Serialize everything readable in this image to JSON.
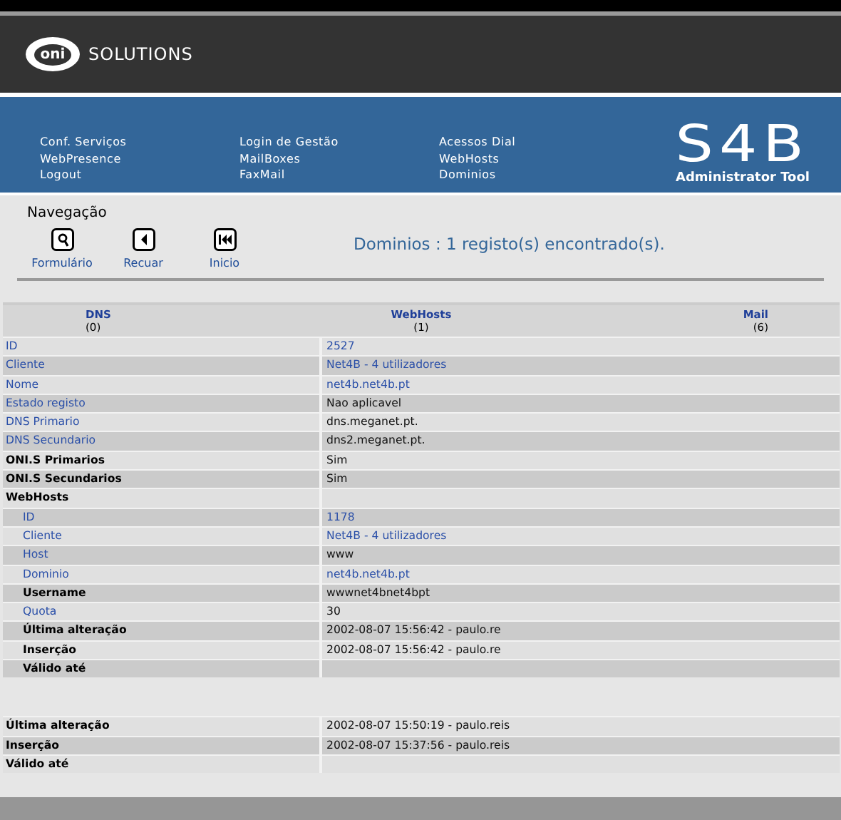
{
  "brand": {
    "logo_mark": "oni",
    "logo_text": "SOLUTIONS",
    "product": "S4B",
    "product_subtitle": "Administrator Tool"
  },
  "menu_columns": [
    [
      "Conf. Serviços",
      "WebPresence",
      "Logout"
    ],
    [
      "Login de Gestão",
      "MailBoxes",
      "FaxMail"
    ],
    [
      "Acessos Dial",
      "WebHosts",
      "Dominios"
    ]
  ],
  "navigation": {
    "title": "Navegação",
    "buttons": [
      {
        "kind": "search",
        "label": "Formulário"
      },
      {
        "kind": "back",
        "label": "Recuar"
      },
      {
        "kind": "first",
        "label": "Inicio"
      }
    ],
    "result": "Dominios : 1 registo(s) encontrado(s)."
  },
  "tabs": [
    {
      "label": "DNS",
      "count": "(0)"
    },
    {
      "label": "WebHosts",
      "count": "(1)"
    },
    {
      "label": "Mail",
      "count": "(6)"
    }
  ],
  "rows": [
    {
      "kind": "field",
      "label": "ID",
      "value": "2527",
      "label_link": true,
      "value_link": true,
      "indented": false
    },
    {
      "kind": "field",
      "label": "Cliente",
      "value": "Net4B - 4 utilizadores",
      "label_link": true,
      "value_link": true,
      "indented": false
    },
    {
      "kind": "field",
      "label": "Nome",
      "value": "net4b.net4b.pt",
      "label_link": true,
      "value_link": true,
      "indented": false
    },
    {
      "kind": "field",
      "label": "Estado registo",
      "value": "Nao aplicavel",
      "label_link": true,
      "value_link": false,
      "indented": false
    },
    {
      "kind": "field",
      "label": "DNS Primario",
      "value": "dns.meganet.pt.",
      "label_link": true,
      "value_link": false,
      "indented": false
    },
    {
      "kind": "field",
      "label": "DNS Secundario",
      "value": "dns2.meganet.pt.",
      "label_link": true,
      "value_link": false,
      "indented": false
    },
    {
      "kind": "field",
      "label": "ONI.S Primarios",
      "value": "Sim",
      "label_link": false,
      "value_link": false,
      "indented": false
    },
    {
      "kind": "field",
      "label": "ONI.S Secundarios",
      "value": "Sim",
      "label_link": false,
      "value_link": false,
      "indented": false
    },
    {
      "kind": "field",
      "label": "WebHosts",
      "label_link": false,
      "indented": false
    },
    {
      "kind": "field",
      "label": "ID",
      "value": "1178",
      "label_link": true,
      "value_link": true,
      "indented": true
    },
    {
      "kind": "field",
      "label": "Cliente",
      "value": "Net4B - 4 utilizadores",
      "label_link": true,
      "value_link": true,
      "indented": true
    },
    {
      "kind": "field",
      "label": "Host",
      "value": "www",
      "label_link": true,
      "value_link": false,
      "indented": true
    },
    {
      "kind": "field",
      "label": "Dominio",
      "value": "net4b.net4b.pt",
      "label_link": true,
      "value_link": true,
      "indented": true
    },
    {
      "kind": "field",
      "label": "Username",
      "value": "wwwnet4bnet4bpt",
      "label_link": false,
      "value_link": false,
      "indented": true
    },
    {
      "kind": "field",
      "label": "Quota",
      "value": "30",
      "label_link": true,
      "value_link": false,
      "indented": true
    },
    {
      "kind": "field",
      "label": "Última alteração",
      "value": "2002-08-07 15:56:42 - paulo.re",
      "label_link": false,
      "value_link": false,
      "indented": true
    },
    {
      "kind": "field",
      "label": "Inserção",
      "value": "2002-08-07 15:56:42 - paulo.re",
      "label_link": false,
      "value_link": false,
      "indented": true
    },
    {
      "kind": "field",
      "label": "Válido até",
      "label_link": false,
      "indented": true
    },
    {
      "kind": "spacer"
    },
    {
      "kind": "field",
      "label": "Última alteração",
      "value": "2002-08-07 15:50:19 - paulo.reis",
      "label_link": false,
      "value_link": false,
      "indented": false
    },
    {
      "kind": "field",
      "label": "Inserção",
      "value": "2002-08-07 15:37:56 - paulo.reis",
      "label_link": false,
      "value_link": false,
      "indented": false
    },
    {
      "kind": "field",
      "label": "Válido até",
      "label_link": false,
      "indented": false
    }
  ]
}
